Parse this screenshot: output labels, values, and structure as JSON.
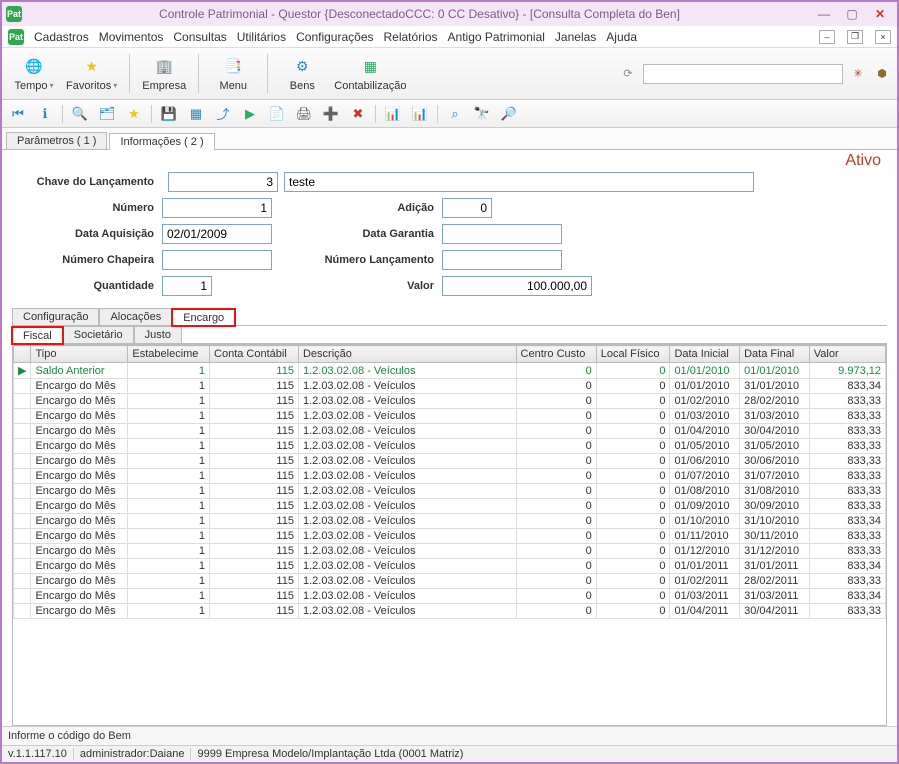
{
  "window": {
    "title": "Controle Patrimonial - Questor {DesconectadoCCC: 0 CC Desativo} - [Consulta Completa do Ben]"
  },
  "menu": {
    "items": [
      "Cadastros",
      "Movimentos",
      "Consultas",
      "Utilitários",
      "Configurações",
      "Relatórios",
      "Antigo Patrimonial",
      "Janelas",
      "Ajuda"
    ]
  },
  "bigtoolbar": {
    "tempo": "Tempo",
    "favoritos": "Favoritos",
    "empresa": "Empresa",
    "menu": "Menu",
    "bens": "Bens",
    "contab": "Contabilização"
  },
  "top_tabs": {
    "parametros": "Parâmetros ( 1 )",
    "informacoes": "Informações ( 2 )"
  },
  "status_badge": "Ativo",
  "form": {
    "chave_label": "Chave do Lançamento",
    "chave_val": "3",
    "chave_desc": "teste",
    "numero_label": "Número",
    "numero_val": "1",
    "adicao_label": "Adição",
    "adicao_val": "0",
    "data_aq_label": "Data Aquisição",
    "data_aq_val": "02/01/2009",
    "data_gar_label": "Data Garantia",
    "data_gar_val": "",
    "chapeira_label": "Número Chapeira",
    "chapeira_val": "",
    "num_lanc_label": "Número Lançamento",
    "num_lanc_val": "",
    "quant_label": "Quantidade",
    "quant_val": "1",
    "valor_label": "Valor",
    "valor_val": "100.000,00"
  },
  "subtabs1": {
    "config": "Configuração",
    "aloc": "Alocações",
    "encargo": "Encargo"
  },
  "subtabs2": {
    "fiscal": "Fiscal",
    "societario": "Societário",
    "justo": "Justo"
  },
  "grid": {
    "headers": {
      "tipo": "Tipo",
      "estab": "Estabelecime",
      "conta": "Conta Contábil",
      "desc": "Descrição",
      "centro": "Centro Custo",
      "local": "Local Físico",
      "dini": "Data Inicial",
      "dfin": "Data Final",
      "valor": "Valor"
    },
    "rows": [
      {
        "mark": "▶",
        "tipo": "Saldo Anterior",
        "estab": "1",
        "conta": "115",
        "desc": "1.2.03.02.08 - Veículos",
        "centro": "0",
        "local": "0",
        "dini": "01/01/2010",
        "dfin": "01/01/2010",
        "valor": "9.973,12",
        "green": true
      },
      {
        "mark": "",
        "tipo": "Encargo do Mês",
        "estab": "1",
        "conta": "115",
        "desc": "1.2.03.02.08 - Veículos",
        "centro": "0",
        "local": "0",
        "dini": "01/01/2010",
        "dfin": "31/01/2010",
        "valor": "833,34"
      },
      {
        "mark": "",
        "tipo": "Encargo do Mês",
        "estab": "1",
        "conta": "115",
        "desc": "1.2.03.02.08 - Veículos",
        "centro": "0",
        "local": "0",
        "dini": "01/02/2010",
        "dfin": "28/02/2010",
        "valor": "833,33"
      },
      {
        "mark": "",
        "tipo": "Encargo do Mês",
        "estab": "1",
        "conta": "115",
        "desc": "1.2.03.02.08 - Veículos",
        "centro": "0",
        "local": "0",
        "dini": "01/03/2010",
        "dfin": "31/03/2010",
        "valor": "833,33"
      },
      {
        "mark": "",
        "tipo": "Encargo do Mês",
        "estab": "1",
        "conta": "115",
        "desc": "1.2.03.02.08 - Veículos",
        "centro": "0",
        "local": "0",
        "dini": "01/04/2010",
        "dfin": "30/04/2010",
        "valor": "833,33"
      },
      {
        "mark": "",
        "tipo": "Encargo do Mês",
        "estab": "1",
        "conta": "115",
        "desc": "1.2.03.02.08 - Veículos",
        "centro": "0",
        "local": "0",
        "dini": "01/05/2010",
        "dfin": "31/05/2010",
        "valor": "833,33"
      },
      {
        "mark": "",
        "tipo": "Encargo do Mês",
        "estab": "1",
        "conta": "115",
        "desc": "1.2.03.02.08 - Veículos",
        "centro": "0",
        "local": "0",
        "dini": "01/06/2010",
        "dfin": "30/06/2010",
        "valor": "833,33"
      },
      {
        "mark": "",
        "tipo": "Encargo do Mês",
        "estab": "1",
        "conta": "115",
        "desc": "1.2.03.02.08 - Veículos",
        "centro": "0",
        "local": "0",
        "dini": "01/07/2010",
        "dfin": "31/07/2010",
        "valor": "833,33"
      },
      {
        "mark": "",
        "tipo": "Encargo do Mês",
        "estab": "1",
        "conta": "115",
        "desc": "1.2.03.02.08 - Veículos",
        "centro": "0",
        "local": "0",
        "dini": "01/08/2010",
        "dfin": "31/08/2010",
        "valor": "833,33"
      },
      {
        "mark": "",
        "tipo": "Encargo do Mês",
        "estab": "1",
        "conta": "115",
        "desc": "1.2.03.02.08 - Veículos",
        "centro": "0",
        "local": "0",
        "dini": "01/09/2010",
        "dfin": "30/09/2010",
        "valor": "833,33"
      },
      {
        "mark": "",
        "tipo": "Encargo do Mês",
        "estab": "1",
        "conta": "115",
        "desc": "1.2.03.02.08 - Veículos",
        "centro": "0",
        "local": "0",
        "dini": "01/10/2010",
        "dfin": "31/10/2010",
        "valor": "833,34"
      },
      {
        "mark": "",
        "tipo": "Encargo do Mês",
        "estab": "1",
        "conta": "115",
        "desc": "1.2.03.02.08 - Veículos",
        "centro": "0",
        "local": "0",
        "dini": "01/11/2010",
        "dfin": "30/11/2010",
        "valor": "833,33"
      },
      {
        "mark": "",
        "tipo": "Encargo do Mês",
        "estab": "1",
        "conta": "115",
        "desc": "1.2.03.02.08 - Veículos",
        "centro": "0",
        "local": "0",
        "dini": "01/12/2010",
        "dfin": "31/12/2010",
        "valor": "833,33"
      },
      {
        "mark": "",
        "tipo": "Encargo do Mês",
        "estab": "1",
        "conta": "115",
        "desc": "1.2.03.02.08 - Veículos",
        "centro": "0",
        "local": "0",
        "dini": "01/01/2011",
        "dfin": "31/01/2011",
        "valor": "833,34"
      },
      {
        "mark": "",
        "tipo": "Encargo do Mês",
        "estab": "1",
        "conta": "115",
        "desc": "1.2.03.02.08 - Veículos",
        "centro": "0",
        "local": "0",
        "dini": "01/02/2011",
        "dfin": "28/02/2011",
        "valor": "833,33"
      },
      {
        "mark": "",
        "tipo": "Encargo do Mês",
        "estab": "1",
        "conta": "115",
        "desc": "1.2.03.02.08 - Veículos",
        "centro": "0",
        "local": "0",
        "dini": "01/03/2011",
        "dfin": "31/03/2011",
        "valor": "833,34"
      },
      {
        "mark": "",
        "tipo": "Encargo do Mês",
        "estab": "1",
        "conta": "115",
        "desc": "1.2.03.02.08 - Veículos",
        "centro": "0",
        "local": "0",
        "dini": "01/04/2011",
        "dfin": "30/04/2011",
        "valor": "833,33"
      }
    ]
  },
  "hint": "Informe o código do Bem",
  "status": {
    "ver": "v.1.1.117.10",
    "user": "administrador:Daiane",
    "empresa": "9999 Empresa Modelo/Implantação Ltda (0001 Matriz)"
  }
}
